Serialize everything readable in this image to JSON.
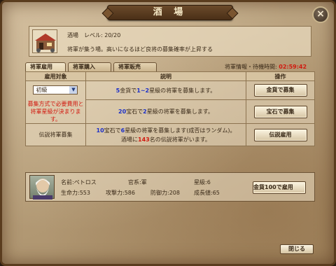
{
  "window": {
    "title": "酒 場",
    "close_icon": "×"
  },
  "building": {
    "name_level": "酒場　レベル: 20/20",
    "description": "将軍が集う場。高いになるほど良将の募集確率が上昇する",
    "icon": "tavern-icon"
  },
  "tabs": [
    {
      "label": "将軍雇用",
      "active": true
    },
    {
      "label": "将軍購入",
      "active": false
    },
    {
      "label": "将軍販売",
      "active": false
    }
  ],
  "timer": {
    "label": "将軍情報・待機時間:",
    "value": "02:59:42"
  },
  "table": {
    "headers": [
      "雇用対象",
      "説明",
      "操作"
    ],
    "select_value": "初級",
    "note": "募集方式で必要費用と将軍星級が決まります。",
    "rows": [
      {
        "desc_pre": "",
        "desc_num1": "5",
        "desc_mid": "金貨で",
        "desc_num2": "1~2",
        "desc_post": "星級の将軍を募集します。",
        "button": "金貨で募集"
      },
      {
        "desc_pre": "",
        "desc_num1": "20",
        "desc_mid": "宝石で",
        "desc_num2": "2",
        "desc_post": "星級の将軍を募集します。",
        "button": "宝石で募集"
      },
      {
        "label": "伝説将軍募集",
        "desc_num1": "10",
        "desc_mid": "宝石で",
        "desc_num2": "6",
        "desc_post": "星級の将軍を募集します(成否はランダム)。",
        "desc2_pre": "酒場に",
        "desc2_num": "143",
        "desc2_post": "名の伝説将軍がいます。",
        "button": "伝説雇用"
      }
    ]
  },
  "general": {
    "name": "名前:ペトロス",
    "office": "官系:軍",
    "stars": "星級:6",
    "hp": "生命力:553",
    "atk": "攻撃力:586",
    "def": "防御力:208",
    "growth": "成長値:65",
    "hire_button": "金貨100で雇用"
  },
  "footer": {
    "close_button": "閉じる"
  }
}
